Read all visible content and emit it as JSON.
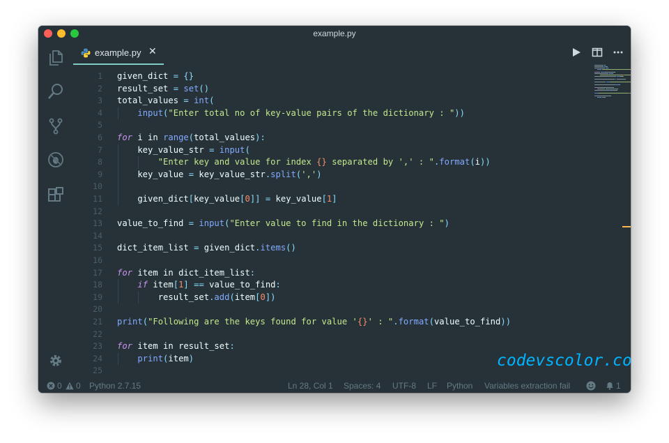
{
  "window": {
    "title": "example.py"
  },
  "tab": {
    "label": "example.py",
    "close_glyph": "✕",
    "icon": "python-icon"
  },
  "activity_bar": {
    "items": [
      "explorer-icon",
      "search-icon",
      "source-control-icon",
      "debug-icon",
      "extensions-icon"
    ],
    "bottom": "gear-icon"
  },
  "editor_actions": [
    "run-icon",
    "split-editor-icon",
    "more-actions-icon"
  ],
  "editor": {
    "lines": [
      {
        "n": "1",
        "t": [
          [
            "pl",
            "given_dict "
          ],
          [
            "op",
            "="
          ],
          [
            "pl",
            " "
          ],
          [
            "op",
            "{}"
          ]
        ]
      },
      {
        "n": "2",
        "t": [
          [
            "pl",
            "result_set "
          ],
          [
            "op",
            "="
          ],
          [
            "pl",
            " "
          ],
          [
            "bi",
            "set"
          ],
          [
            "op",
            "()"
          ]
        ]
      },
      {
        "n": "3",
        "t": [
          [
            "pl",
            "total_values "
          ],
          [
            "op",
            "="
          ],
          [
            "pl",
            " "
          ],
          [
            "bi",
            "int"
          ],
          [
            "op",
            "("
          ]
        ]
      },
      {
        "n": "4",
        "t": [
          [
            "pl",
            "    "
          ],
          [
            "bi",
            "input"
          ],
          [
            "op",
            "("
          ],
          [
            "str",
            "\"Enter total no of key-value pairs of the dictionary : \""
          ],
          [
            "op",
            "))"
          ]
        ]
      },
      {
        "n": "5",
        "t": []
      },
      {
        "n": "6",
        "t": [
          [
            "kw",
            "for"
          ],
          [
            "pl",
            " i "
          ],
          [
            "pl",
            "in"
          ],
          [
            "pl",
            " "
          ],
          [
            "bi",
            "range"
          ],
          [
            "op",
            "("
          ],
          [
            "pl",
            "total_values"
          ],
          [
            "op",
            "):"
          ]
        ]
      },
      {
        "n": "7",
        "t": [
          [
            "pl",
            "    key_value_str "
          ],
          [
            "op",
            "="
          ],
          [
            "pl",
            " "
          ],
          [
            "bi",
            "input"
          ],
          [
            "op",
            "("
          ]
        ]
      },
      {
        "n": "8",
        "t": [
          [
            "pl",
            "        "
          ],
          [
            "str",
            "\"Enter key and value for index "
          ],
          [
            "fmt",
            "{}"
          ],
          [
            "str",
            " separated by ',' : \""
          ],
          [
            "op",
            "."
          ],
          [
            "fn",
            "format"
          ],
          [
            "op",
            "("
          ],
          [
            "pl",
            "i"
          ],
          [
            "op",
            "))"
          ]
        ]
      },
      {
        "n": "9",
        "t": [
          [
            "pl",
            "    key_value "
          ],
          [
            "op",
            "="
          ],
          [
            "pl",
            " key_value_str"
          ],
          [
            "op",
            "."
          ],
          [
            "fn",
            "split"
          ],
          [
            "op",
            "("
          ],
          [
            "str",
            "','"
          ],
          [
            "op",
            ")"
          ]
        ]
      },
      {
        "n": "10",
        "t": []
      },
      {
        "n": "11",
        "t": [
          [
            "pl",
            "    given_dict"
          ],
          [
            "op",
            "["
          ],
          [
            "pl",
            "key_value"
          ],
          [
            "op",
            "["
          ],
          [
            "num",
            "0"
          ],
          [
            "op",
            "]]"
          ],
          [
            "pl",
            " "
          ],
          [
            "op",
            "="
          ],
          [
            "pl",
            " key_value"
          ],
          [
            "op",
            "["
          ],
          [
            "num",
            "1"
          ],
          [
            "op",
            "]"
          ]
        ]
      },
      {
        "n": "12",
        "t": []
      },
      {
        "n": "13",
        "t": [
          [
            "pl",
            "value_to_find "
          ],
          [
            "op",
            "="
          ],
          [
            "pl",
            " "
          ],
          [
            "bi",
            "input"
          ],
          [
            "op",
            "("
          ],
          [
            "str",
            "\"Enter value to find in the dictionary : \""
          ],
          [
            "op",
            ")"
          ]
        ]
      },
      {
        "n": "14",
        "t": []
      },
      {
        "n": "15",
        "t": [
          [
            "pl",
            "dict_item_list "
          ],
          [
            "op",
            "="
          ],
          [
            "pl",
            " given_dict"
          ],
          [
            "op",
            "."
          ],
          [
            "fn",
            "items"
          ],
          [
            "op",
            "()"
          ]
        ]
      },
      {
        "n": "16",
        "t": []
      },
      {
        "n": "17",
        "t": [
          [
            "kw",
            "for"
          ],
          [
            "pl",
            " item "
          ],
          [
            "pl",
            "in"
          ],
          [
            "pl",
            " dict_item_list"
          ],
          [
            "op",
            ":"
          ]
        ]
      },
      {
        "n": "18",
        "t": [
          [
            "pl",
            "    "
          ],
          [
            "kw",
            "if"
          ],
          [
            "pl",
            " item"
          ],
          [
            "op",
            "["
          ],
          [
            "num",
            "1"
          ],
          [
            "op",
            "]"
          ],
          [
            "pl",
            " "
          ],
          [
            "op",
            "=="
          ],
          [
            "pl",
            " value_to_find"
          ],
          [
            "op",
            ":"
          ]
        ]
      },
      {
        "n": "19",
        "t": [
          [
            "pl",
            "        result_set"
          ],
          [
            "op",
            "."
          ],
          [
            "fn",
            "add"
          ],
          [
            "op",
            "("
          ],
          [
            "pl",
            "item"
          ],
          [
            "op",
            "["
          ],
          [
            "num",
            "0"
          ],
          [
            "op",
            "])"
          ]
        ]
      },
      {
        "n": "20",
        "t": []
      },
      {
        "n": "21",
        "t": [
          [
            "bi",
            "print"
          ],
          [
            "op",
            "("
          ],
          [
            "str",
            "\"Following are the keys found for value '"
          ],
          [
            "fmt",
            "{}"
          ],
          [
            "str",
            "' : \""
          ],
          [
            "op",
            "."
          ],
          [
            "fn",
            "format"
          ],
          [
            "op",
            "("
          ],
          [
            "pl",
            "value_to_find"
          ],
          [
            "op",
            "))"
          ]
        ]
      },
      {
        "n": "22",
        "t": []
      },
      {
        "n": "23",
        "t": [
          [
            "kw",
            "for"
          ],
          [
            "pl",
            " item "
          ],
          [
            "pl",
            "in"
          ],
          [
            "pl",
            " result_set"
          ],
          [
            "op",
            ":"
          ]
        ]
      },
      {
        "n": "24",
        "t": [
          [
            "pl",
            "    "
          ],
          [
            "bi",
            "print"
          ],
          [
            "op",
            "("
          ],
          [
            "pl",
            "item"
          ],
          [
            "op",
            ")"
          ]
        ]
      },
      {
        "n": "25",
        "t": []
      }
    ]
  },
  "watermark": "codevscolor.com",
  "status_bar": {
    "errors": "0",
    "warnings": "0",
    "interpreter": "Python 2.7.15",
    "cursor": "Ln 28, Col 1",
    "spaces": "Spaces: 4",
    "encoding": "UTF-8",
    "eol": "LF",
    "language": "Python",
    "message": "Variables extraction fail",
    "notifications": "1"
  },
  "colors": {
    "background": "#263238",
    "accent": "#80cbc4",
    "keyword": "#c792ea",
    "function": "#82aaff",
    "string": "#c3e88d",
    "number": "#f78c6c",
    "operator": "#89ddff",
    "watermark": "#00b4ff"
  }
}
